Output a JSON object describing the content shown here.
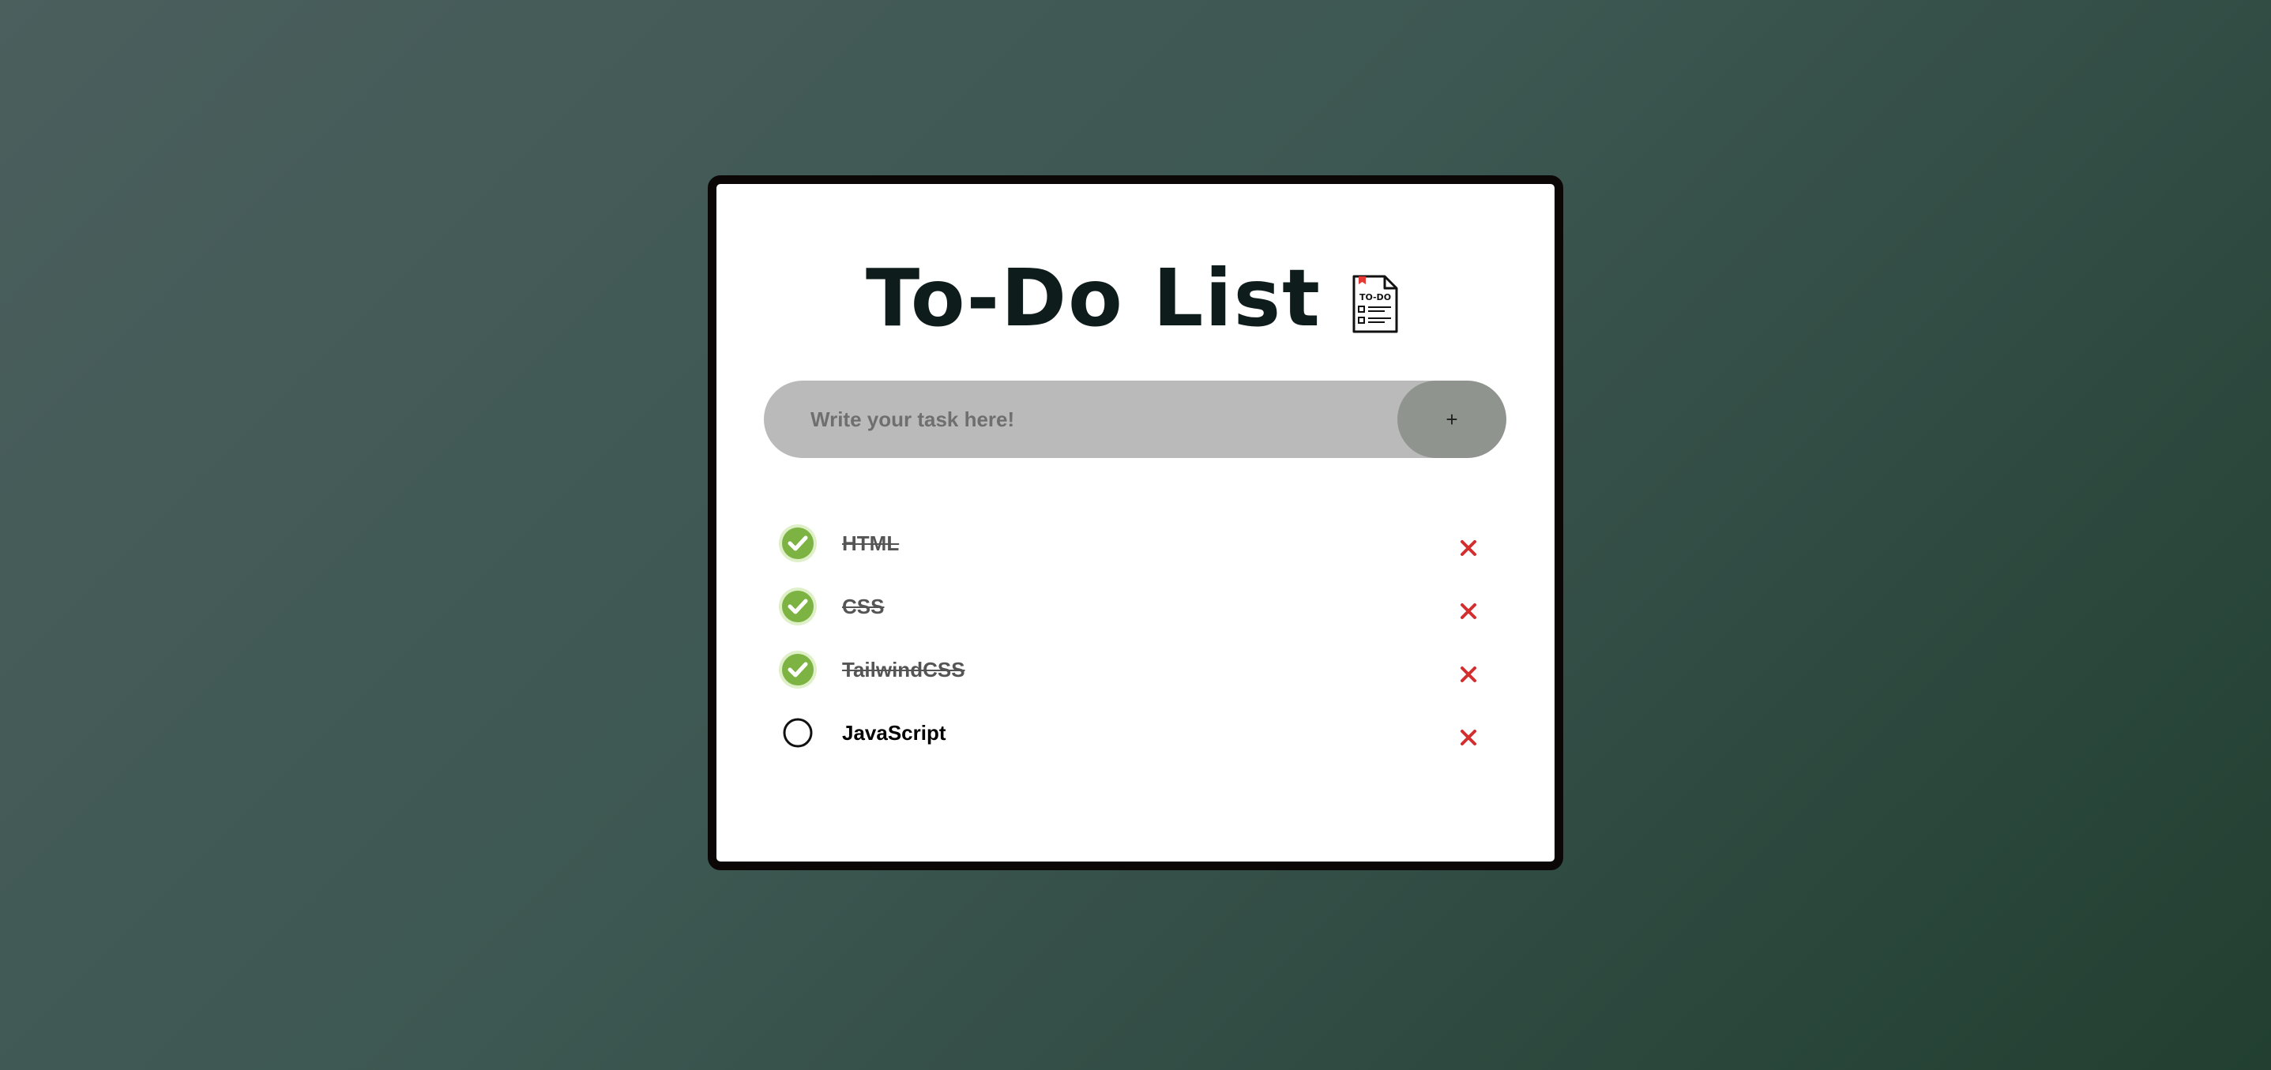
{
  "app": {
    "title": "To-Do List",
    "title_icon": "todo-document-icon"
  },
  "input": {
    "placeholder": "Write your task here!",
    "value": "",
    "add_button_label": "+"
  },
  "tasks": [
    {
      "label": "HTML",
      "done": true
    },
    {
      "label": "CSS",
      "done": true
    },
    {
      "label": "TailwindCSS",
      "done": true
    },
    {
      "label": "JavaScript",
      "done": false
    }
  ],
  "icons": {
    "checked": "checked-circle-icon",
    "unchecked": "unchecked-circle-icon",
    "delete": "close-icon"
  },
  "colors": {
    "card_border": "#0b0707",
    "input_bg": "#bbbaba",
    "add_button_bg": "#8f948f",
    "check_green": "#7cb342",
    "delete_red": "#d32f2f",
    "title_text": "#0e1c1b"
  }
}
